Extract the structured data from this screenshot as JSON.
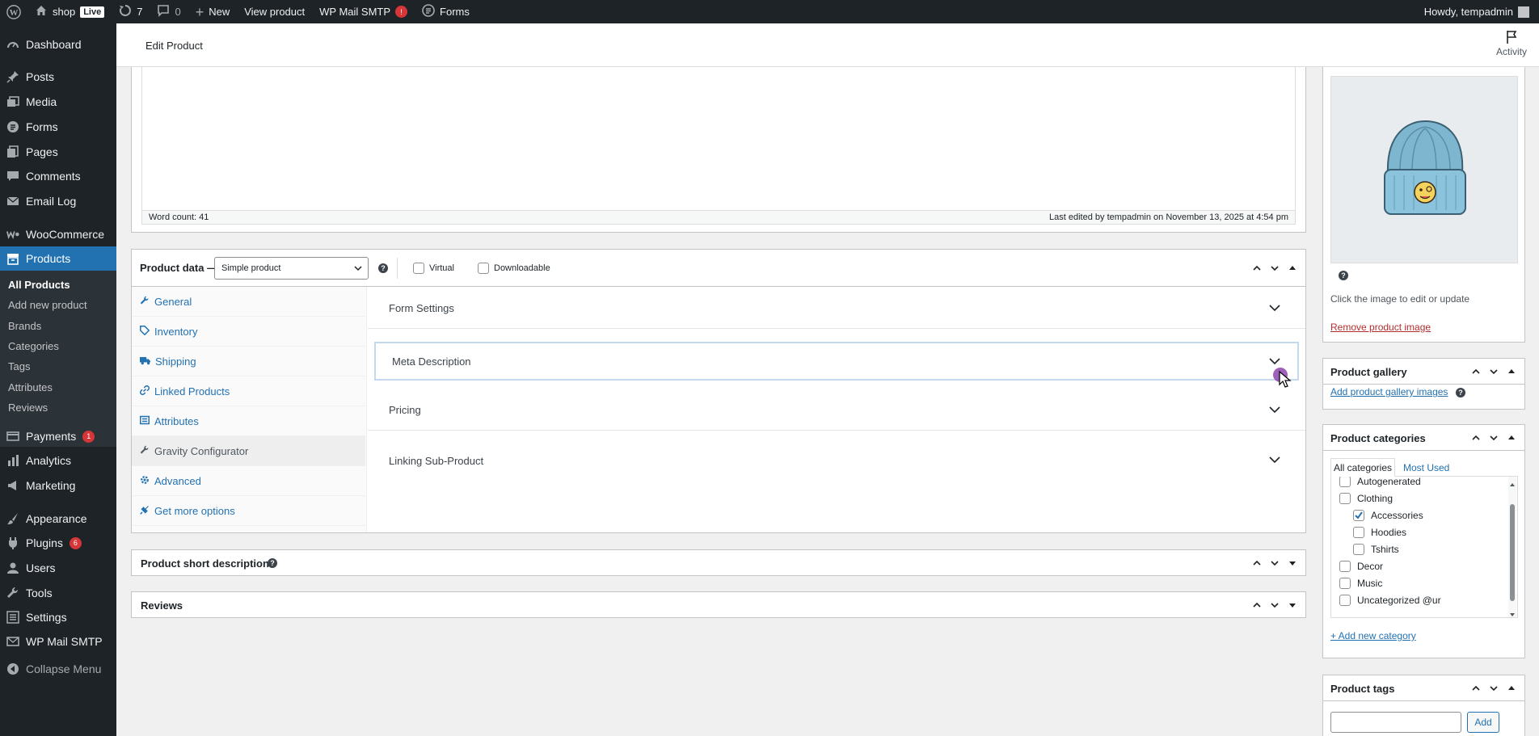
{
  "adminbar": {
    "site_name": "shop",
    "live_badge": "Live",
    "updates_count": "7",
    "comments_count": "0",
    "new_label": "New",
    "view_product_label": "View product",
    "smtp_label": "WP Mail SMTP",
    "smtp_badge": "!",
    "forms_label": "Forms",
    "howdy": "Howdy, tempadmin"
  },
  "sidebar": {
    "items": [
      {
        "label": "Dashboard",
        "icon": "dashboard-icon"
      },
      {
        "label": "Posts",
        "icon": "pin-icon"
      },
      {
        "label": "Media",
        "icon": "media-icon"
      },
      {
        "label": "Forms",
        "icon": "forms-icon"
      },
      {
        "label": "Pages",
        "icon": "pages-icon"
      },
      {
        "label": "Comments",
        "icon": "comment-icon"
      },
      {
        "label": "Email Log",
        "icon": "email-icon"
      },
      {
        "label": "WooCommerce",
        "icon": "woo-icon"
      },
      {
        "label": "Products",
        "icon": "archive-icon"
      },
      {
        "label": "Payments",
        "icon": "payments-icon",
        "badge": "1"
      },
      {
        "label": "Analytics",
        "icon": "chart-icon"
      },
      {
        "label": "Marketing",
        "icon": "megaphone-icon"
      },
      {
        "label": "Appearance",
        "icon": "brush-icon"
      },
      {
        "label": "Plugins",
        "icon": "plugin-icon",
        "badge": "6"
      },
      {
        "label": "Users",
        "icon": "users-icon"
      },
      {
        "label": "Tools",
        "icon": "wrench-icon"
      },
      {
        "label": "Settings",
        "icon": "settings-icon"
      },
      {
        "label": "WP Mail SMTP",
        "icon": "mail-icon"
      },
      {
        "label": "Collapse Menu",
        "icon": "collapse-icon"
      }
    ],
    "submenu": [
      "All Products",
      "Add new product",
      "Brands",
      "Categories",
      "Tags",
      "Attributes",
      "Reviews"
    ]
  },
  "header": {
    "title": "Edit Product",
    "activity_label": "Activity"
  },
  "editor": {
    "word_count": "Word count: 41",
    "last_edited": "Last edited by tempadmin on November 13, 2025 at 4:54 pm"
  },
  "product_data": {
    "label": "Product data —",
    "type_select": "Simple product",
    "virtual_label": "Virtual",
    "downloadable_label": "Downloadable",
    "tabs": [
      "General",
      "Inventory",
      "Shipping",
      "Linked Products",
      "Attributes",
      "Gravity Configurator",
      "Advanced",
      "Get more options"
    ],
    "active_tab": "Gravity Configurator",
    "sections": [
      "Form Settings",
      "Meta Description",
      "Pricing",
      "Linking Sub-Product"
    ]
  },
  "short_description": {
    "title": "Product short description"
  },
  "reviews": {
    "title": "Reviews"
  },
  "product_image": {
    "hint": "Click the image to edit or update",
    "remove_link": "Remove product image"
  },
  "gallery": {
    "title": "Product gallery",
    "add_link": "Add product gallery images"
  },
  "categories": {
    "title": "Product categories",
    "tab_all": "All categories",
    "tab_most": "Most Used",
    "items": [
      {
        "label": "Autogenerated",
        "checked": false,
        "level": 0
      },
      {
        "label": "Clothing",
        "checked": false,
        "level": 0
      },
      {
        "label": "Accessories",
        "checked": true,
        "level": 1
      },
      {
        "label": "Hoodies",
        "checked": false,
        "level": 1
      },
      {
        "label": "Tshirts",
        "checked": false,
        "level": 1
      },
      {
        "label": "Decor",
        "checked": false,
        "level": 0
      },
      {
        "label": "Music",
        "checked": false,
        "level": 0
      },
      {
        "label": "Uncategorized @ur",
        "checked": false,
        "level": 0
      }
    ],
    "add_link": "+ Add new category"
  },
  "tags": {
    "title": "Product tags",
    "input_value": "",
    "add_button": "Add"
  },
  "colors": {
    "adminbar_bg": "#1d2327",
    "accent": "#2271b1",
    "badge_red": "#d63638",
    "cursor_purple": "#8e44ad"
  }
}
